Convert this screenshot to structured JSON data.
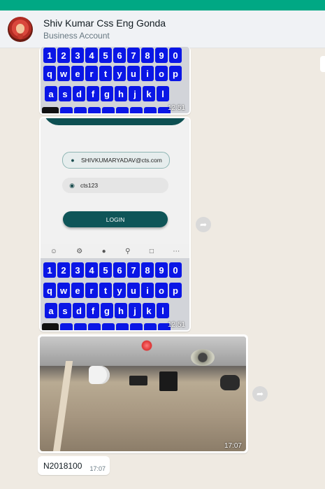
{
  "header": {
    "contact_name": "Shiv Kumar Css Eng Gonda",
    "contact_subtitle": "Business Account"
  },
  "keyboard": {
    "number_row": [
      "1",
      "2",
      "3",
      "4",
      "5",
      "6",
      "7",
      "8",
      "9",
      "0"
    ],
    "row1": [
      "q",
      "w",
      "e",
      "r",
      "t",
      "y",
      "u",
      "i",
      "o",
      "p"
    ],
    "row2": [
      "a",
      "s",
      "d",
      "f",
      "g",
      "h",
      "j",
      "k",
      "l"
    ]
  },
  "messages": {
    "msg1_time": "12:51",
    "msg2": {
      "email_value": "SHIVKUMARYADAV@cts.com",
      "password_value": "cts123",
      "login_label": "LOGIN",
      "time": "12:51"
    },
    "msg3_time": "17:07",
    "msg4": {
      "text": "N2018100",
      "time": "17:07"
    }
  },
  "icons": {
    "forward": "forward-icon",
    "user": "user-icon",
    "eye_off": "eye-off-icon"
  },
  "colors": {
    "accent": "#00a884",
    "keyboard_key": "#0a16e6",
    "login_button": "#0f5558"
  }
}
